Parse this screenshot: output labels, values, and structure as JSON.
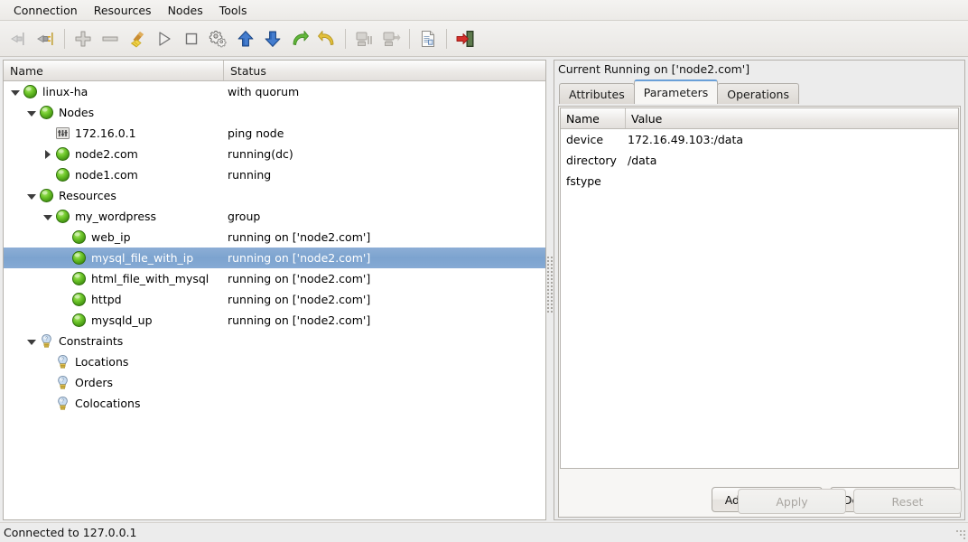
{
  "menu": {
    "items": [
      {
        "label": "Connection"
      },
      {
        "label": "Resources"
      },
      {
        "label": "Nodes"
      },
      {
        "label": "Tools"
      }
    ]
  },
  "toolbar": {
    "buttons": [
      {
        "name": "disconnect-icon",
        "title": "Disconnect",
        "enabled": false
      },
      {
        "name": "connect-plug-icon",
        "title": "Connect",
        "enabled": true
      },
      {
        "name": "separator-1",
        "title": "",
        "enabled": false
      },
      {
        "name": "add-plus-icon",
        "title": "Add",
        "enabled": true
      },
      {
        "name": "remove-minus-icon",
        "title": "Remove",
        "enabled": true
      },
      {
        "name": "cleanup-broom-icon",
        "title": "Cleanup",
        "enabled": true
      },
      {
        "name": "start-play-icon",
        "title": "Start",
        "enabled": true
      },
      {
        "name": "stop-square-icon",
        "title": "Stop",
        "enabled": true
      },
      {
        "name": "manage-gears-icon",
        "title": "Manage",
        "enabled": true
      },
      {
        "name": "move-up-arrow-icon",
        "title": "Move Up",
        "enabled": true
      },
      {
        "name": "move-down-arrow-icon",
        "title": "Move Down",
        "enabled": true
      },
      {
        "name": "redo-arrow-icon",
        "title": "Migrate",
        "enabled": true
      },
      {
        "name": "undo-arrow-icon",
        "title": "Unmigrate",
        "enabled": true
      },
      {
        "name": "separator-2",
        "title": "",
        "enabled": false
      },
      {
        "name": "node-standby-icon",
        "title": "Standby Node",
        "enabled": false
      },
      {
        "name": "node-online-icon",
        "title": "Online Node",
        "enabled": false
      },
      {
        "name": "separator-3",
        "title": "",
        "enabled": false
      },
      {
        "name": "document-cib-icon",
        "title": "CIB",
        "enabled": true
      },
      {
        "name": "separator-4",
        "title": "",
        "enabled": false
      },
      {
        "name": "exit-door-icon",
        "title": "Quit",
        "enabled": true
      }
    ]
  },
  "tree": {
    "columns": {
      "name": "Name",
      "status": "Status"
    },
    "rows": [
      {
        "indent": 0,
        "twist": "open",
        "icon": "green-ball-icon",
        "name": "linux-ha",
        "status": "with quorum",
        "selected": false
      },
      {
        "indent": 1,
        "twist": "open",
        "icon": "green-ball-icon",
        "name": "Nodes",
        "status": "",
        "selected": false
      },
      {
        "indent": 2,
        "twist": "none",
        "icon": "ping-node-icon",
        "name": "172.16.0.1",
        "status": "ping node",
        "selected": false
      },
      {
        "indent": 2,
        "twist": "closed",
        "icon": "green-ball-icon",
        "name": "node2.com",
        "status": "running(dc)",
        "selected": false
      },
      {
        "indent": 2,
        "twist": "none",
        "icon": "green-ball-icon",
        "name": "node1.com",
        "status": "running",
        "selected": false
      },
      {
        "indent": 1,
        "twist": "open",
        "icon": "green-ball-icon",
        "name": "Resources",
        "status": "",
        "selected": false
      },
      {
        "indent": 2,
        "twist": "open",
        "icon": "green-ball-icon",
        "name": "my_wordpress",
        "status": "group",
        "selected": false
      },
      {
        "indent": 3,
        "twist": "none",
        "icon": "green-ball-icon",
        "name": "web_ip",
        "status": "running on ['node2.com']",
        "selected": false
      },
      {
        "indent": 3,
        "twist": "none",
        "icon": "green-ball-icon",
        "name": "mysql_file_with_ip",
        "status": "running on ['node2.com']",
        "selected": true
      },
      {
        "indent": 3,
        "twist": "none",
        "icon": "green-ball-icon",
        "name": "html_file_with_mysql",
        "status": "running on ['node2.com']",
        "selected": false
      },
      {
        "indent": 3,
        "twist": "none",
        "icon": "green-ball-icon",
        "name": "httpd",
        "status": "running on ['node2.com']",
        "selected": false
      },
      {
        "indent": 3,
        "twist": "none",
        "icon": "green-ball-icon",
        "name": "mysqld_up",
        "status": "running on ['node2.com']",
        "selected": false
      },
      {
        "indent": 1,
        "twist": "open",
        "icon": "lightbulb-icon",
        "name": "Constraints",
        "status": "",
        "selected": false
      },
      {
        "indent": 2,
        "twist": "none",
        "icon": "lightbulb-icon",
        "name": "Locations",
        "status": "",
        "selected": false
      },
      {
        "indent": 2,
        "twist": "none",
        "icon": "lightbulb-icon",
        "name": "Orders",
        "status": "",
        "selected": false
      },
      {
        "indent": 2,
        "twist": "none",
        "icon": "lightbulb-icon",
        "name": "Colocations",
        "status": "",
        "selected": false
      }
    ]
  },
  "details": {
    "running_label": "Current Running on ['node2.com']",
    "tabs": [
      {
        "label": "Attributes",
        "active": false
      },
      {
        "label": "Parameters",
        "active": true
      },
      {
        "label": "Operations",
        "active": false
      }
    ],
    "parameters": {
      "columns": {
        "name": "Name",
        "value": "Value"
      },
      "rows": [
        {
          "name": "device",
          "value": "172.16.49.103:/data"
        },
        {
          "name": "directory",
          "value": "/data"
        },
        {
          "name": "fstype",
          "value": ""
        }
      ]
    },
    "buttons": {
      "add": "Add Parameter",
      "delete": "Delete Parameter",
      "apply": "Apply",
      "reset": "Reset"
    }
  },
  "statusbar": {
    "text": "Connected to 127.0.0.1"
  },
  "colors": {
    "selection": "#7ca3cf",
    "active_tab_accent": "#6aa0d8",
    "status_ok": "#5fbe22",
    "window_bg": "#ececec"
  }
}
